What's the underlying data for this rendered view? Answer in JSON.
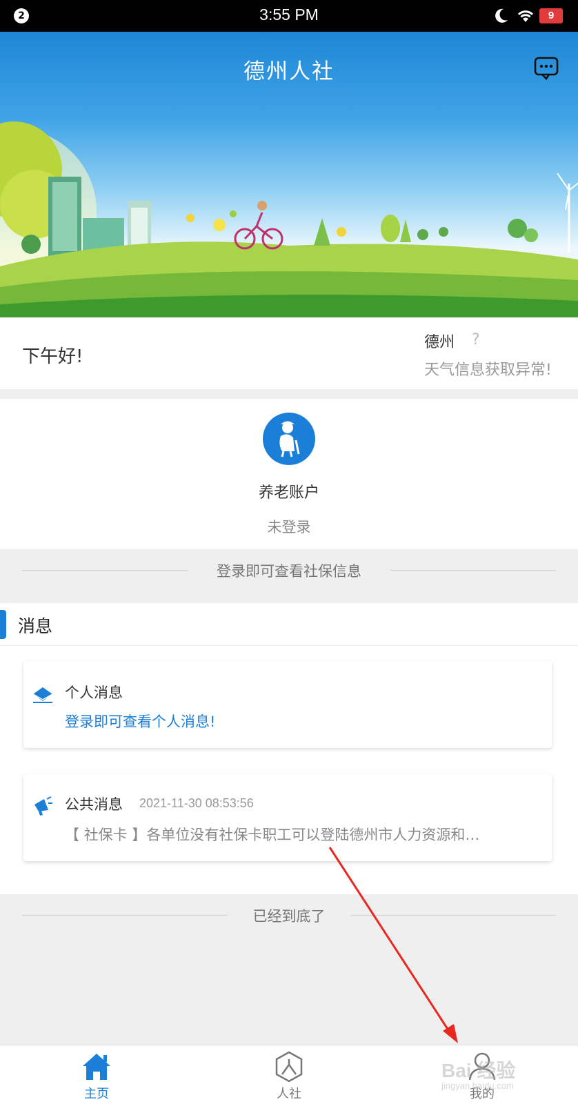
{
  "status_bar": {
    "notification_count": "2",
    "time": "3:55 PM",
    "battery": "9",
    "icons": [
      "moon-icon",
      "wifi-icon",
      "battery-icon"
    ]
  },
  "header": {
    "title": "德州人社",
    "message_icon": "chat-bubble-icon"
  },
  "greeting": {
    "text": "下午好!",
    "city": "德州",
    "weather_icon": "?",
    "weather_status": "天气信息获取异常!"
  },
  "pension": {
    "label": "养老账户",
    "state": "未登录",
    "icon": "elderly-person-icon"
  },
  "login_hint": "登录即可查看社保信息",
  "messages": {
    "section_title": "消息",
    "personal": {
      "title": "个人消息",
      "subtitle": "登录即可查看个人消息!",
      "icon": "envelope-icon"
    },
    "public": {
      "title": "公共消息",
      "date": "2021-11-30 08:53:56",
      "summary": "【 社保卡 】各单位没有社保卡职工可以登陆德州市人力资源和…",
      "icon": "megaphone-icon"
    }
  },
  "end_text": "已经到底了",
  "nav": {
    "items": [
      {
        "label": "主页",
        "icon": "home-icon",
        "active": true
      },
      {
        "label": "人社",
        "icon": "person-shield-icon",
        "active": false
      },
      {
        "label": "我的",
        "icon": "user-icon",
        "active": false
      }
    ]
  },
  "watermark": {
    "text": "Bai 经验",
    "url": "jingyan.baidu.com"
  },
  "colors": {
    "accent": "#1b7fd8",
    "annotation_arrow": "#e8281e"
  }
}
